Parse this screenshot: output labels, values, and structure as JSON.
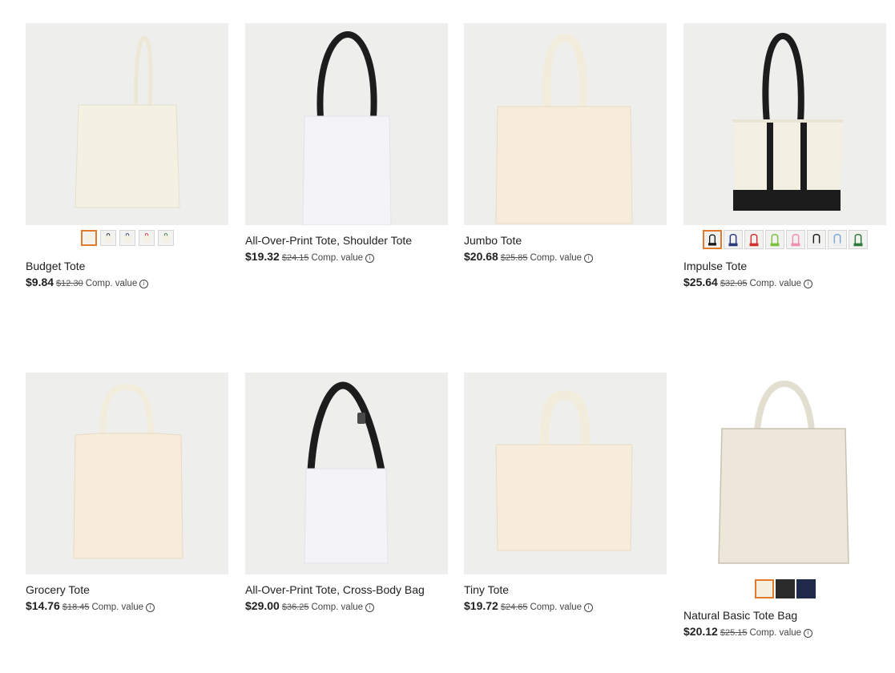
{
  "products": [
    {
      "title": "Budget Tote",
      "price": "$9.84",
      "was": "$12.30",
      "comp_label": "Comp. value",
      "swatches": [
        "natural",
        "black",
        "navy",
        "red",
        "green"
      ]
    },
    {
      "title": "All-Over-Print Tote, Shoulder Tote",
      "price": "$19.32",
      "was": "$24.15",
      "comp_label": "Comp. value"
    },
    {
      "title": "Jumbo Tote",
      "price": "$20.68",
      "was": "$25.85",
      "comp_label": "Comp. value"
    },
    {
      "title": "Impulse Tote",
      "price": "$25.64",
      "was": "$32.05",
      "comp_label": "Comp. value",
      "swatches": [
        "black",
        "navy",
        "red",
        "lime",
        "pink",
        "black",
        "light-blue",
        "green"
      ]
    },
    {
      "title": "Grocery Tote",
      "price": "$14.76",
      "was": "$18.45",
      "comp_label": "Comp. value"
    },
    {
      "title": "All-Over-Print Tote, Cross-Body Bag",
      "price": "$29.00",
      "was": "$36.25",
      "comp_label": "Comp. value"
    },
    {
      "title": "Tiny Tote",
      "price": "$19.72",
      "was": "$24.65",
      "comp_label": "Comp. value"
    },
    {
      "title": "Natural Basic Tote Bag",
      "price": "$20.12",
      "was": "$25.15",
      "comp_label": "Comp. value",
      "swatches": [
        "natural",
        "black",
        "navy"
      ]
    }
  ],
  "info_glyph": "i",
  "colors": {
    "selected_border": "#e07a2c",
    "canvas": "#f7f0e2",
    "black_handle": "#1c1c1c",
    "white_tote": "#f3f3f8"
  }
}
